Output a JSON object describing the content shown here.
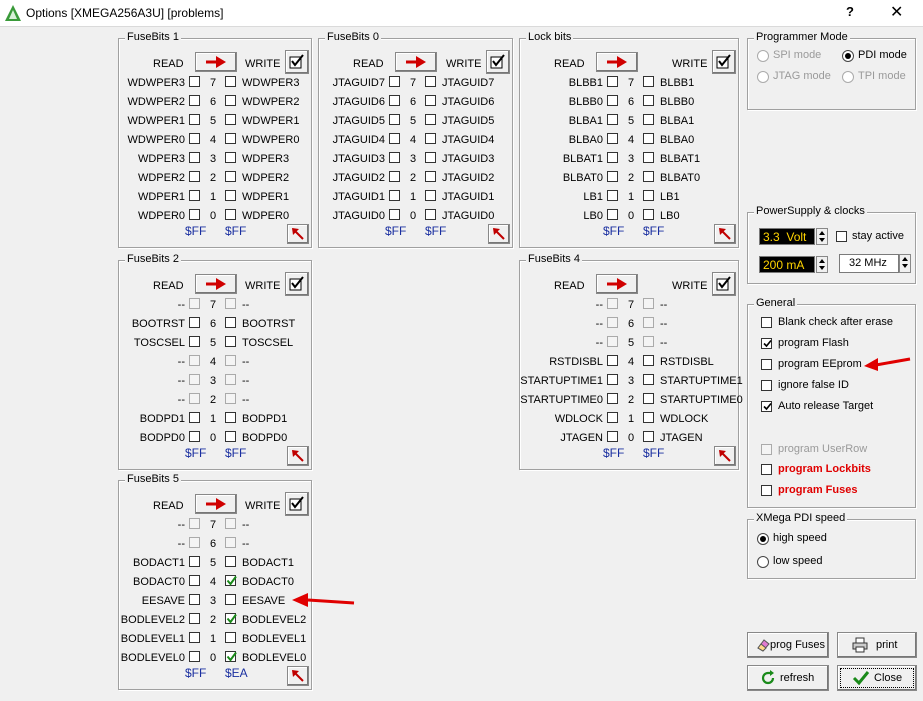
{
  "window": {
    "title": "Options [XMEGA256A3U] [problems]",
    "help": "?",
    "close": "✕"
  },
  "labels": {
    "read": "READ",
    "write": "WRITE"
  },
  "fuse1": {
    "title": "FuseBits 1",
    "rows": [
      {
        "l": "WDWPER3",
        "b": "7",
        "r": "WDWPER3",
        "lc": false,
        "rc": false
      },
      {
        "l": "WDWPER2",
        "b": "6",
        "r": "WDWPER2",
        "lc": false,
        "rc": false
      },
      {
        "l": "WDWPER1",
        "b": "5",
        "r": "WDWPER1",
        "lc": false,
        "rc": false
      },
      {
        "l": "WDWPER0",
        "b": "4",
        "r": "WDWPER0",
        "lc": false,
        "rc": false
      },
      {
        "l": "WDPER3",
        "b": "3",
        "r": "WDPER3",
        "lc": false,
        "rc": false
      },
      {
        "l": "WDPER2",
        "b": "2",
        "r": "WDPER2",
        "lc": false,
        "rc": false
      },
      {
        "l": "WDPER1",
        "b": "1",
        "r": "WDPER1",
        "lc": false,
        "rc": false
      },
      {
        "l": "WDPER0",
        "b": "0",
        "r": "WDPER0",
        "lc": false,
        "rc": false
      }
    ],
    "readhex": "$FF",
    "writehex": "$FF"
  },
  "fuse0": {
    "title": "FuseBits 0",
    "rows": [
      {
        "l": "JTAGUID7",
        "b": "7",
        "r": "JTAGUID7",
        "lc": false,
        "rc": false
      },
      {
        "l": "JTAGUID6",
        "b": "6",
        "r": "JTAGUID6",
        "lc": false,
        "rc": false
      },
      {
        "l": "JTAGUID5",
        "b": "5",
        "r": "JTAGUID5",
        "lc": false,
        "rc": false
      },
      {
        "l": "JTAGUID4",
        "b": "4",
        "r": "JTAGUID4",
        "lc": false,
        "rc": false
      },
      {
        "l": "JTAGUID3",
        "b": "3",
        "r": "JTAGUID3",
        "lc": false,
        "rc": false
      },
      {
        "l": "JTAGUID2",
        "b": "2",
        "r": "JTAGUID2",
        "lc": false,
        "rc": false
      },
      {
        "l": "JTAGUID1",
        "b": "1",
        "r": "JTAGUID1",
        "lc": false,
        "rc": false
      },
      {
        "l": "JTAGUID0",
        "b": "0",
        "r": "JTAGUID0",
        "lc": false,
        "rc": false
      }
    ],
    "readhex": "$FF",
    "writehex": "$FF"
  },
  "lock": {
    "title": "Lock bits",
    "rows": [
      {
        "l": "BLBB1",
        "b": "7",
        "r": "BLBB1",
        "lc": false,
        "rc": false
      },
      {
        "l": "BLBB0",
        "b": "6",
        "r": "BLBB0",
        "lc": false,
        "rc": false
      },
      {
        "l": "BLBA1",
        "b": "5",
        "r": "BLBA1",
        "lc": false,
        "rc": false
      },
      {
        "l": "BLBA0",
        "b": "4",
        "r": "BLBA0",
        "lc": false,
        "rc": false
      },
      {
        "l": "BLBAT1",
        "b": "3",
        "r": "BLBAT1",
        "lc": false,
        "rc": false
      },
      {
        "l": "BLBAT0",
        "b": "2",
        "r": "BLBAT0",
        "lc": false,
        "rc": false
      },
      {
        "l": "LB1",
        "b": "1",
        "r": "LB1",
        "lc": false,
        "rc": false
      },
      {
        "l": "LB0",
        "b": "0",
        "r": "LB0",
        "lc": false,
        "rc": false
      }
    ],
    "readhex": "$FF",
    "writehex": "$FF"
  },
  "fuse2": {
    "title": "FuseBits 2",
    "rows": [
      {
        "l": "--",
        "b": "7",
        "r": "--",
        "lc": false,
        "rc": false,
        "dis": true
      },
      {
        "l": "BOOTRST",
        "b": "6",
        "r": "BOOTRST",
        "lc": false,
        "rc": false
      },
      {
        "l": "TOSCSEL",
        "b": "5",
        "r": "TOSCSEL",
        "lc": false,
        "rc": false
      },
      {
        "l": "--",
        "b": "4",
        "r": "--",
        "lc": false,
        "rc": false,
        "dis": true
      },
      {
        "l": "--",
        "b": "3",
        "r": "--",
        "lc": false,
        "rc": false,
        "dis": true
      },
      {
        "l": "--",
        "b": "2",
        "r": "--",
        "lc": false,
        "rc": false,
        "dis": true
      },
      {
        "l": "BODPD1",
        "b": "1",
        "r": "BODPD1",
        "lc": false,
        "rc": false
      },
      {
        "l": "BODPD0",
        "b": "0",
        "r": "BODPD0",
        "lc": false,
        "rc": false
      }
    ],
    "readhex": "$FF",
    "writehex": "$FF"
  },
  "fuse4": {
    "title": "FuseBits 4",
    "rows": [
      {
        "l": "--",
        "b": "7",
        "r": "--",
        "lc": false,
        "rc": false,
        "dis": true
      },
      {
        "l": "--",
        "b": "6",
        "r": "--",
        "lc": false,
        "rc": false,
        "dis": true
      },
      {
        "l": "--",
        "b": "5",
        "r": "--",
        "lc": false,
        "rc": false,
        "dis": true
      },
      {
        "l": "RSTDISBL",
        "b": "4",
        "r": "RSTDISBL",
        "lc": false,
        "rc": false
      },
      {
        "l": "STARTUPTIME1",
        "b": "3",
        "r": "STARTUPTIME1",
        "lc": false,
        "rc": false
      },
      {
        "l": "STARTUPTIME0",
        "b": "2",
        "r": "STARTUPTIME0",
        "lc": false,
        "rc": false
      },
      {
        "l": "WDLOCK",
        "b": "1",
        "r": "WDLOCK",
        "lc": false,
        "rc": false
      },
      {
        "l": "JTAGEN",
        "b": "0",
        "r": "JTAGEN",
        "lc": false,
        "rc": false
      }
    ],
    "readhex": "$FF",
    "writehex": "$FF"
  },
  "fuse5": {
    "title": "FuseBits 5",
    "rows": [
      {
        "l": "--",
        "b": "7",
        "r": "--",
        "lc": false,
        "rc": false,
        "dis": true
      },
      {
        "l": "--",
        "b": "6",
        "r": "--",
        "lc": false,
        "rc": false,
        "dis": true
      },
      {
        "l": "BODACT1",
        "b": "5",
        "r": "BODACT1",
        "lc": false,
        "rc": false
      },
      {
        "l": "BODACT0",
        "b": "4",
        "r": "BODACT0",
        "lc": false,
        "rc": true
      },
      {
        "l": "EESAVE",
        "b": "3",
        "r": "EESAVE",
        "lc": false,
        "rc": false
      },
      {
        "l": "BODLEVEL2",
        "b": "2",
        "r": "BODLEVEL2",
        "lc": false,
        "rc": true
      },
      {
        "l": "BODLEVEL1",
        "b": "1",
        "r": "BODLEVEL1",
        "lc": false,
        "rc": false
      },
      {
        "l": "BODLEVEL0",
        "b": "0",
        "r": "BODLEVEL0",
        "lc": false,
        "rc": true
      }
    ],
    "readhex": "$FF",
    "writehex": "$EA"
  },
  "programmer": {
    "title": "Programmer Mode",
    "spi": "SPI mode",
    "pdi": "PDI mode",
    "jtag": "JTAG mode",
    "tpi": "TPI mode"
  },
  "power": {
    "title": "PowerSupply & clocks",
    "voltage": "3.3  Volt",
    "current": "200 mA",
    "stay": "stay active",
    "clock": "32 MHz"
  },
  "general": {
    "title": "General",
    "blank": "Blank check after erase",
    "flash": "program Flash",
    "eeprom": "program EEprom",
    "ignore": "ignore false ID",
    "auto": "Auto release Target",
    "userrow": "program UserRow",
    "lockbits": "program Lockbits",
    "fuses": "program Fuses"
  },
  "pdi": {
    "title": "XMega PDI speed",
    "high": "high speed",
    "low": "low speed"
  },
  "buttons": {
    "progfuses": "prog Fuses",
    "print": "print",
    "refresh": "refresh",
    "close": "Close"
  },
  "colors": {
    "accent": "#e00000",
    "hex": "#1a2fa0",
    "led_bg": "#000000",
    "led_fg": "#ffd400",
    "check": "#1a8a1a"
  }
}
